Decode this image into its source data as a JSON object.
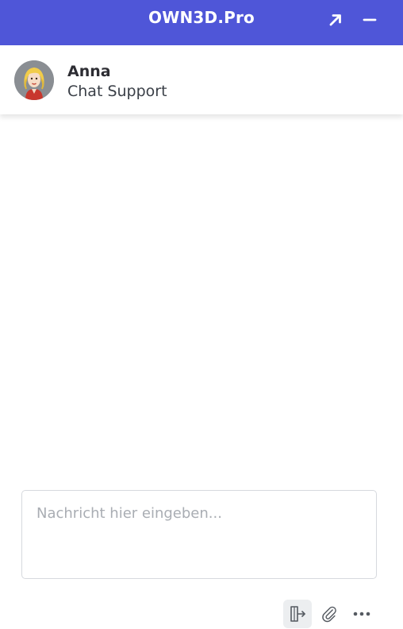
{
  "header": {
    "title": "OWN3D.Pro",
    "background": "#4f56d8",
    "expand_icon": "arrow-up-right-icon",
    "minimize_icon": "minus-icon"
  },
  "agent": {
    "name": "Anna",
    "role": "Chat Support",
    "avatar_icon": "avatar-blonde-woman"
  },
  "composer": {
    "placeholder": "Nachricht hier eingeben...",
    "value": ""
  },
  "actions": {
    "end_chat_icon": "exit-door-icon",
    "attach_icon": "paperclip-icon",
    "more_icon": "more-dots-icon"
  }
}
